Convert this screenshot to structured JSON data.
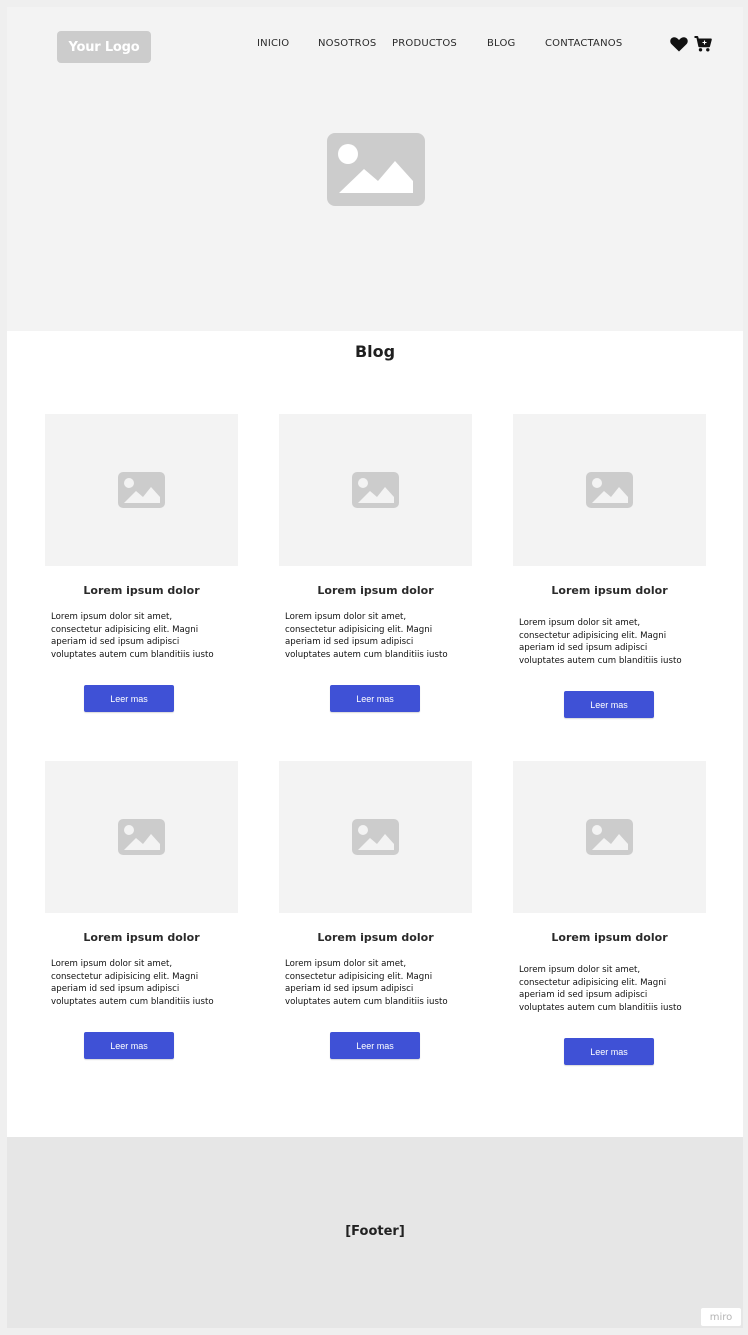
{
  "header": {
    "logo_text": "Your Logo",
    "nav": [
      {
        "label": "INICIO"
      },
      {
        "label": "NOSOTROS"
      },
      {
        "label": "PRODUCTOS"
      },
      {
        "label": "BLOG"
      },
      {
        "label": "CONTACTANOS"
      }
    ],
    "icons": {
      "favorites": "heart-icon",
      "cart": "cart-icon"
    }
  },
  "hero": {
    "image": "image-placeholder-icon"
  },
  "main": {
    "title": "Blog",
    "cards": [
      {
        "title": "Lorem ipsum dolor",
        "lines": [
          "Lorem ipsum dolor sit amet,",
          "consectetur adipisicing elit. Magni",
          "aperiam id sed ipsum adipisci",
          "voluptates autem cum blanditiis iusto"
        ],
        "button": "Leer mas"
      },
      {
        "title": "Lorem ipsum dolor",
        "lines": [
          "Lorem ipsum dolor sit amet,",
          "consectetur adipisicing elit. Magni",
          "aperiam id sed ipsum adipisci",
          "voluptates autem cum blanditiis iusto"
        ],
        "button": "Leer mas"
      },
      {
        "title": "Lorem ipsum dolor",
        "lines": [
          "Lorem ipsum dolor sit amet,",
          "consectetur adipisicing elit. Magni",
          "aperiam id sed ipsum adipisci",
          "voluptates autem cum blanditiis iusto"
        ],
        "button": "Leer mas"
      },
      {
        "title": "Lorem ipsum dolor",
        "lines": [
          "Lorem ipsum dolor sit amet,",
          "consectetur adipisicing elit. Magni",
          "aperiam id sed ipsum adipisci",
          "voluptates autem cum blanditiis iusto"
        ],
        "button": "Leer mas"
      },
      {
        "title": "Lorem ipsum dolor",
        "lines": [
          "Lorem ipsum dolor sit amet,",
          "consectetur adipisicing elit. Magni",
          "aperiam id sed ipsum adipisci",
          "voluptates autem cum blanditiis iusto"
        ],
        "button": "Leer mas"
      },
      {
        "title": "Lorem ipsum dolor",
        "lines": [
          "Lorem ipsum dolor sit amet,",
          "consectetur adipisicing elit. Magni",
          "aperiam id sed ipsum adipisci",
          "voluptates autem cum blanditiis iusto"
        ],
        "button": "Leer mas"
      }
    ]
  },
  "footer": {
    "label": "[Footer]"
  },
  "watermark": "miro",
  "colors": {
    "accent": "#3f51d6",
    "placeholder": "#cccccc",
    "hero_bg": "#f3f3f3",
    "footer_bg": "#e6e6e6"
  }
}
